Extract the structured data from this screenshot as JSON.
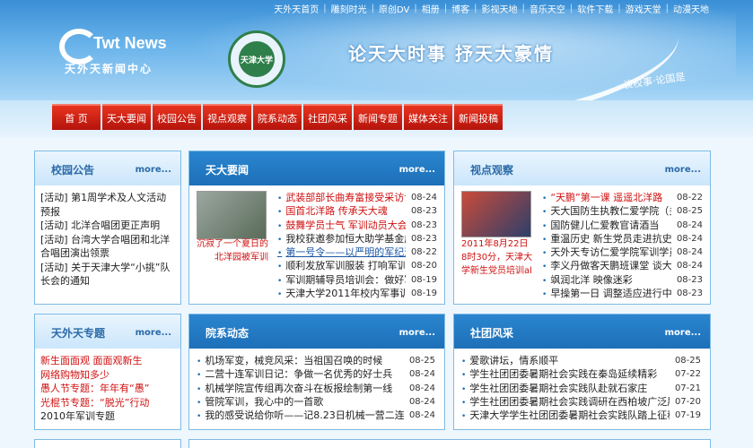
{
  "topnav": [
    "天外天首页",
    "雕刻时光",
    "原创DV",
    "相册",
    "博客",
    "影视天地",
    "音乐天空",
    "软件下载",
    "游戏天堂",
    "动漫天地"
  ],
  "logo": {
    "brand": "Twt News",
    "name": "天外天新闻中心"
  },
  "emblem": {
    "text": "天津大学"
  },
  "slogan": "论天大时事 抒天大豪情",
  "slogan_small": "谈校事·论国是",
  "mainnav": [
    "首 页",
    "天大要闻",
    "校园公告",
    "视点观察",
    "院系动态",
    "社团风采",
    "新闻专题",
    "媒体关注",
    "新闻投稿"
  ],
  "panels": {
    "notice": {
      "title": "校园公告",
      "more": "more...",
      "items": [
        "[活动] 第1周学术及人文活动预报",
        "[活动] 北洋合唱团更正声明",
        "[活动] 台湾大学合唱团和北洋合唱团演出领票",
        "[活动] 关于天津大学“小挑”队长会的通知"
      ]
    },
    "news": {
      "title": "天大要闻",
      "more": "more...",
      "photo_caption": "沉寂了一个夏日的北洋园被军训",
      "items": [
        {
          "text": "武装部部长曲寿富接受采访谈军训",
          "date": "08-24"
        },
        {
          "text": "国首北洋路 传承天大魂",
          "date": "08-23"
        },
        {
          "text": "鼓舞学员士气 军训动员大会圆满",
          "date": "08-23"
        },
        {
          "text": "我校获邀参加恒大助学基金成立",
          "date": "08-23"
        },
        {
          "text": "第一号令——以严明的军纪迎接",
          "date": "08-22"
        },
        {
          "text": "顺利发放军训服装 打响军训第一",
          "date": "08-20"
        },
        {
          "text": "军训期辅导员培训会：做好军",
          "date": "08-19"
        },
        {
          "text": "天津大学2011年校内军事训练实",
          "date": "08-19"
        }
      ]
    },
    "view": {
      "title": "视点观察",
      "more": "more...",
      "photo_caption": "2011年8月22日8时30分，天津大学新生党员培训al",
      "items": [
        {
          "text": "“天鹏”第一课 遥遥北洋路",
          "date": "08-22"
        },
        {
          "text": "天大国防生执教仁爱学院（多图",
          "date": "08-25"
        },
        {
          "text": "国防健儿仁爱教官请酒当",
          "date": "08-24"
        },
        {
          "text": "重温历史 新生党员走进抗史馆",
          "date": "08-24"
        },
        {
          "text": "天外天专访仁爱学院军训学员",
          "date": "08-24"
        },
        {
          "text": "李义丹做客天鹏班课堂 谈大学的",
          "date": "08-24"
        },
        {
          "text": "飒润北洋 映像迷彩",
          "date": "08-23"
        },
        {
          "text": "早操第一日 调整适应进行中",
          "date": "08-23"
        }
      ]
    },
    "special": {
      "title": "天外天专题",
      "more": "more...",
      "items": [
        "新生面面观 面面观新生",
        "网络购物知多少",
        "愚人节专题：年年有“愚”",
        "光棍节专题：“脱光”行动",
        "2010年军训专题"
      ]
    },
    "dept": {
      "title": "院系动态",
      "more": "more...",
      "items": [
        {
          "text": "机场军变，械竞风采：当祖国召唤的时候",
          "date": "08-25"
        },
        {
          "text": "二营十连军训日记：争做一名优秀的好士兵",
          "date": "08-24"
        },
        {
          "text": "机械学院宣传组再次奋斗在板报绘制第一线",
          "date": "08-24"
        },
        {
          "text": "管院军训，我心中的一首歌",
          "date": "08-24"
        },
        {
          "text": "我的感受说给你听——记8.23日机械一营二连二排训军",
          "date": "08-24"
        }
      ]
    },
    "club": {
      "title": "社团风采",
      "more": "more...",
      "items": [
        {
          "text": "爱歌讲坛，情系顺平",
          "date": "08-25"
        },
        {
          "text": "学生社团团委暑期社会实践在秦岛延续精彩",
          "date": "07-22"
        },
        {
          "text": "学生社团团委暑期社会实践队赴就石家庄",
          "date": "07-21"
        },
        {
          "text": "学生社团团委暑期社会实践调研在西柏坡广泛展开",
          "date": "07-20"
        },
        {
          "text": "天津大学学生社团团委暑期社会实践队踏上征程",
          "date": "07-19"
        }
      ]
    }
  }
}
